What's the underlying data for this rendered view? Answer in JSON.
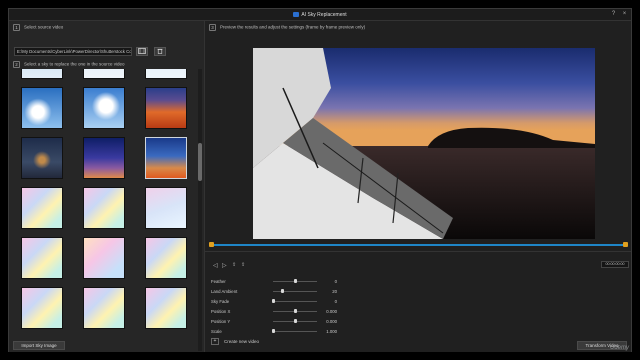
{
  "window": {
    "title": "AI Sky Replacement",
    "help_label": "?",
    "close_label": "×"
  },
  "left_panel": {
    "step1_number": "1",
    "step1_label": "Select source video",
    "file_path": "E:\\My Documents\\CyberLink\\PowerDirector\\Shutterstock Co",
    "step2_number": "2",
    "step2_label": "Select a sky to replace the one in the source video",
    "import_label": "Import Sky Image",
    "sky_thumbnails": [
      {
        "style": "pale-blue-haze"
      },
      {
        "style": "pale-blue"
      },
      {
        "style": "pale-blue-light"
      },
      {
        "style": "blue-clouds"
      },
      {
        "style": "blue-clouds-bright"
      },
      {
        "style": "orange-sunset"
      },
      {
        "style": "dark-cloudy-dusk"
      },
      {
        "style": "blue-purple-dusk"
      },
      {
        "style": "blue-orange-sunset",
        "selected": true
      },
      {
        "style": "pastel-rainbow"
      },
      {
        "style": "pastel-rainbow"
      },
      {
        "style": "pastel-clouds"
      },
      {
        "style": "pastel-rainbow"
      },
      {
        "style": "pastel-rainbow-2"
      },
      {
        "style": "pastel-rainbow"
      },
      {
        "style": "pastel-rainbow"
      },
      {
        "style": "pastel-rainbow"
      },
      {
        "style": "pastel-rainbow"
      }
    ]
  },
  "right_panel": {
    "step3_number": "3",
    "step3_label": "Preview the results and adjust the settings (frame by frame preview only)",
    "timecode": "00:00:00:00",
    "playback_position": 0.0,
    "settings": [
      {
        "label": "Feather",
        "value": "0",
        "level": 0.5
      },
      {
        "label": "Land Ambient",
        "value": "20",
        "level": 0.2
      },
      {
        "label": "Sky Fade",
        "value": "0",
        "level": 0.0
      },
      {
        "label": "Position X",
        "value": "0.000",
        "level": 0.5
      },
      {
        "label": "Position Y",
        "value": "0.000",
        "level": 0.5
      },
      {
        "label": "Scale",
        "value": "1.000",
        "level": 0.0
      }
    ],
    "create_label": "Create new video",
    "transform_label": "Transform Video"
  },
  "watermark": "Udemy",
  "colors": {
    "accent_blue": "#1f86c8",
    "handle_orange": "#e0a020",
    "panel": "#262626"
  }
}
